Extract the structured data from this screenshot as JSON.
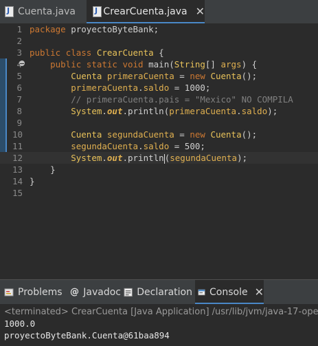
{
  "editor_tabs": [
    {
      "label": "Cuenta.java",
      "active": false
    },
    {
      "label": "CrearCuenta.java",
      "active": true
    }
  ],
  "code": {
    "lines": [
      {
        "num": "1",
        "tokens": [
          {
            "t": "package",
            "c": "kw"
          },
          {
            "t": " proyectoByteBank;"
          }
        ]
      },
      {
        "num": "2",
        "tokens": []
      },
      {
        "num": "3",
        "tokens": [
          {
            "t": "public",
            "c": "kw"
          },
          {
            "t": " "
          },
          {
            "t": "class",
            "c": "kw"
          },
          {
            "t": " "
          },
          {
            "t": "CrearCuenta",
            "c": "cls"
          },
          {
            "t": " {"
          }
        ]
      },
      {
        "num": "4",
        "tokens": [
          {
            "t": "    "
          },
          {
            "t": "public",
            "c": "kw"
          },
          {
            "t": " "
          },
          {
            "t": "static",
            "c": "kw"
          },
          {
            "t": " "
          },
          {
            "t": "void",
            "c": "kw"
          },
          {
            "t": " main("
          },
          {
            "t": "String",
            "c": "cls"
          },
          {
            "t": "[] "
          },
          {
            "t": "args",
            "c": "var"
          },
          {
            "t": ") {"
          }
        ]
      },
      {
        "num": "5",
        "tokens": [
          {
            "t": "        "
          },
          {
            "t": "Cuenta",
            "c": "cls"
          },
          {
            "t": " "
          },
          {
            "t": "primeraCuenta",
            "c": "var"
          },
          {
            "t": " = "
          },
          {
            "t": "new",
            "c": "kw"
          },
          {
            "t": " "
          },
          {
            "t": "Cuenta",
            "c": "cls"
          },
          {
            "t": "();"
          }
        ]
      },
      {
        "num": "6",
        "tokens": [
          {
            "t": "        "
          },
          {
            "t": "primeraCuenta",
            "c": "var"
          },
          {
            "t": "."
          },
          {
            "t": "saldo",
            "c": "fld"
          },
          {
            "t": " = 1000;"
          }
        ]
      },
      {
        "num": "7",
        "tokens": [
          {
            "t": "        "
          },
          {
            "t": "// primeraCuenta.pais = \"Mexico\" NO COMPILA",
            "c": "cmt"
          }
        ]
      },
      {
        "num": "8",
        "tokens": [
          {
            "t": "        "
          },
          {
            "t": "System",
            "c": "cls"
          },
          {
            "t": "."
          },
          {
            "t": "out",
            "c": "sta"
          },
          {
            "t": ".println("
          },
          {
            "t": "primeraCuenta",
            "c": "var"
          },
          {
            "t": "."
          },
          {
            "t": "saldo",
            "c": "fld"
          },
          {
            "t": ");"
          }
        ]
      },
      {
        "num": "9",
        "tokens": []
      },
      {
        "num": "10",
        "tokens": [
          {
            "t": "        "
          },
          {
            "t": "Cuenta",
            "c": "cls"
          },
          {
            "t": " "
          },
          {
            "t": "segundaCuenta",
            "c": "var"
          },
          {
            "t": " = "
          },
          {
            "t": "new",
            "c": "kw"
          },
          {
            "t": " "
          },
          {
            "t": "Cuenta",
            "c": "cls"
          },
          {
            "t": "();"
          }
        ]
      },
      {
        "num": "11",
        "tokens": [
          {
            "t": "        "
          },
          {
            "t": "segundaCuenta",
            "c": "var"
          },
          {
            "t": "."
          },
          {
            "t": "saldo",
            "c": "fld"
          },
          {
            "t": " = 500;"
          }
        ]
      },
      {
        "num": "12",
        "tokens": [
          {
            "t": "        "
          },
          {
            "t": "System",
            "c": "cls"
          },
          {
            "t": "."
          },
          {
            "t": "out",
            "c": "sta"
          },
          {
            "t": ".println"
          },
          {
            "caret": true
          },
          {
            "t": "("
          },
          {
            "t": "segundaCuenta",
            "c": "var"
          },
          {
            "t": ");"
          }
        ]
      },
      {
        "num": "13",
        "tokens": [
          {
            "t": "    }"
          }
        ]
      },
      {
        "num": "14",
        "tokens": [
          {
            "t": "}"
          }
        ]
      },
      {
        "num": "15",
        "tokens": []
      }
    ],
    "current_line": 12
  },
  "panel_tabs": [
    {
      "label": "Problems",
      "icon": "problems-icon",
      "active": false
    },
    {
      "label": "Javadoc",
      "icon": "javadoc-icon",
      "active": false
    },
    {
      "label": "Declaration",
      "icon": "declaration-icon",
      "active": false
    },
    {
      "label": "Console",
      "icon": "console-icon",
      "active": true
    }
  ],
  "console": {
    "status": "<terminated> CrearCuenta [Java Application] /usr/lib/jvm/java-17-ope",
    "output": [
      "1000.0",
      "proyectoByteBank.Cuenta@61baa894"
    ]
  },
  "colors": {
    "editor_bg": "#2b2b2b",
    "keyword": "#cc7832",
    "active_tab_accent": "#4a88c7"
  }
}
